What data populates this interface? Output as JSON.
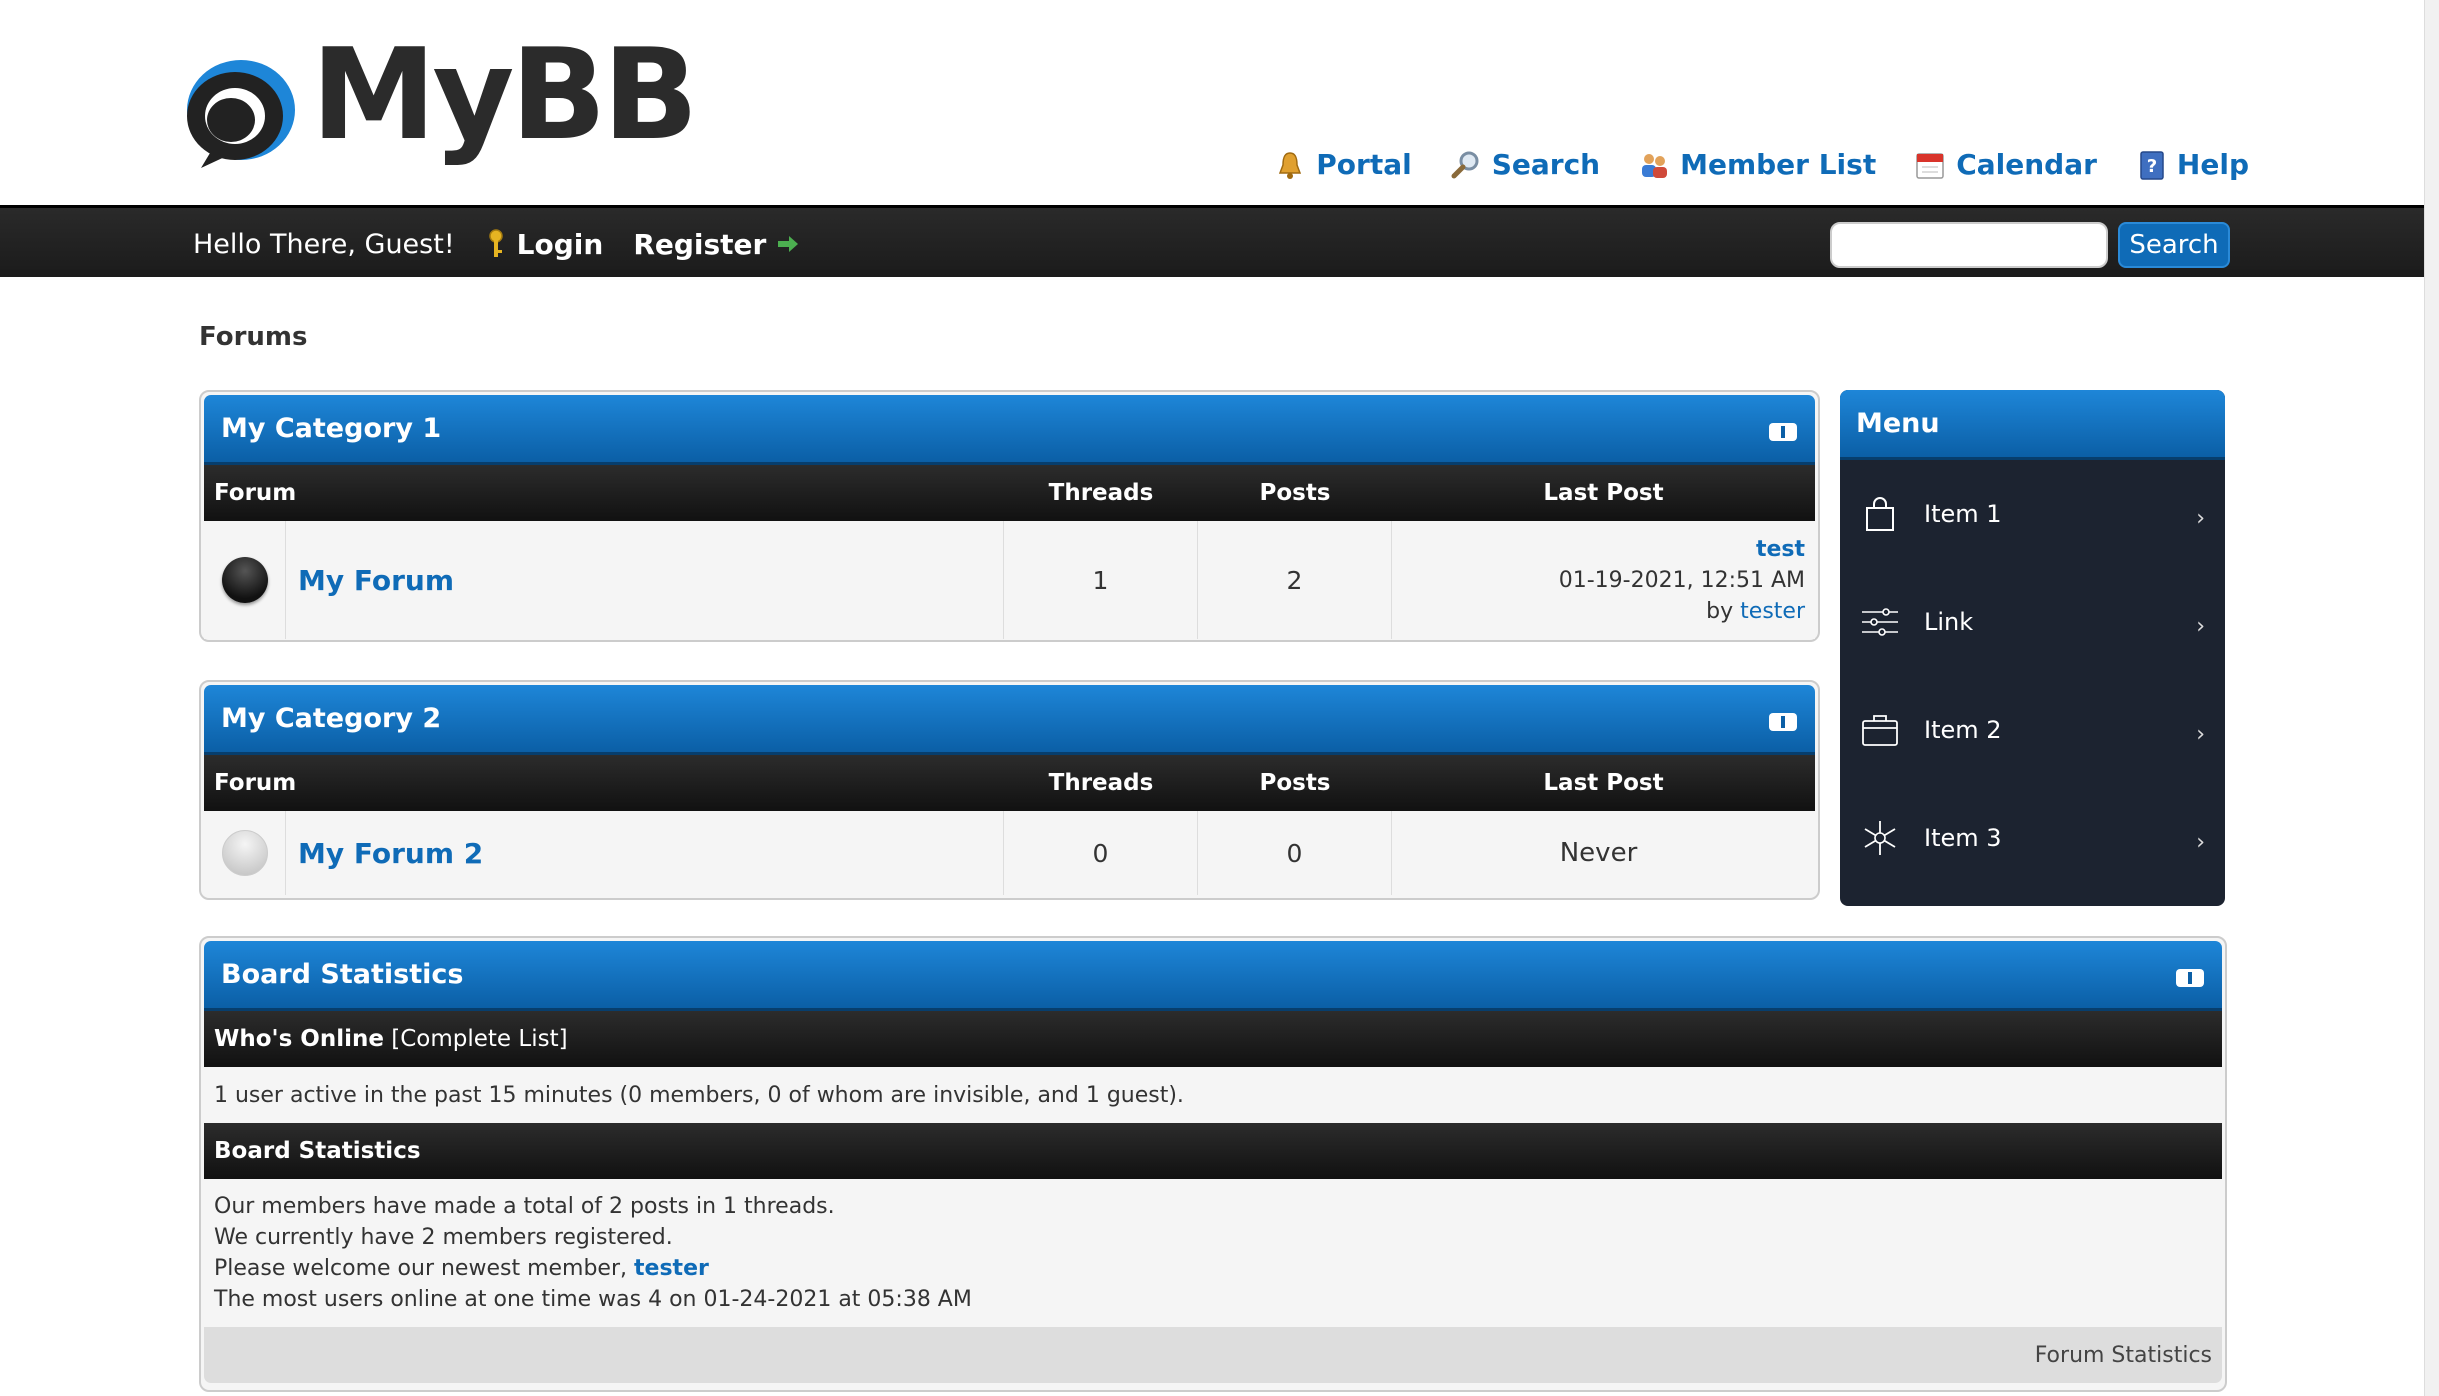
{
  "header": {
    "logo_text": "MyBB",
    "toplinks": [
      {
        "label": "Portal",
        "icon": "bell-icon"
      },
      {
        "label": "Search",
        "icon": "magnifier-icon"
      },
      {
        "label": "Member List",
        "icon": "members-icon"
      },
      {
        "label": "Calendar",
        "icon": "calendar-icon"
      },
      {
        "label": "Help",
        "icon": "help-book-icon"
      }
    ]
  },
  "navbar": {
    "greeting": "Hello There, Guest!",
    "login": "Login",
    "register": "Register",
    "search_button": "Search",
    "search_value": ""
  },
  "forums_title": "Forums",
  "columns": {
    "forum": "Forum",
    "threads": "Threads",
    "posts": "Posts",
    "last_post": "Last Post"
  },
  "categories": [
    {
      "name": "My Category 1",
      "forums": [
        {
          "name": "My Forum",
          "threads": "1",
          "posts": "2",
          "status": "on",
          "last_post": {
            "title": "test",
            "date": "01-19-2021, 12:51 AM",
            "by": "by",
            "author": "tester"
          }
        }
      ]
    },
    {
      "name": "My Category 2",
      "forums": [
        {
          "name": "My Forum 2",
          "threads": "0",
          "posts": "0",
          "status": "off",
          "last_post": {
            "never": "Never"
          }
        }
      ]
    }
  ],
  "menu": {
    "title": "Menu",
    "items": [
      {
        "label": "Item 1",
        "icon": "shopping-bag-icon"
      },
      {
        "label": "Link",
        "icon": "sliders-icon"
      },
      {
        "label": "Item 2",
        "icon": "briefcase-icon"
      },
      {
        "label": "Item 3",
        "icon": "asterisk-icon"
      }
    ],
    "chevron": "›"
  },
  "stats": {
    "title": "Board Statistics",
    "whos_online_label": "Who's Online",
    "complete_list": "[Complete List]",
    "online_text": "1 user active in the past 15 minutes (0 members, 0 of whom are invisible, and 1 guest).",
    "board_stats_label": "Board Statistics",
    "line1": "Our members have made a total of 2 posts in 1 threads.",
    "line2": "We currently have 2 members registered.",
    "line3_prefix": "Please welcome our newest member,",
    "newest_member": "tester",
    "line4": "The most users online at one time was 4 on 01-24-2021 at 05:38 AM",
    "footer_link": "Forum Statistics"
  },
  "colors": {
    "accent": "#0f6bb7",
    "dark_bar": "#1b1b1b",
    "menu_bg": "#1c2330"
  }
}
